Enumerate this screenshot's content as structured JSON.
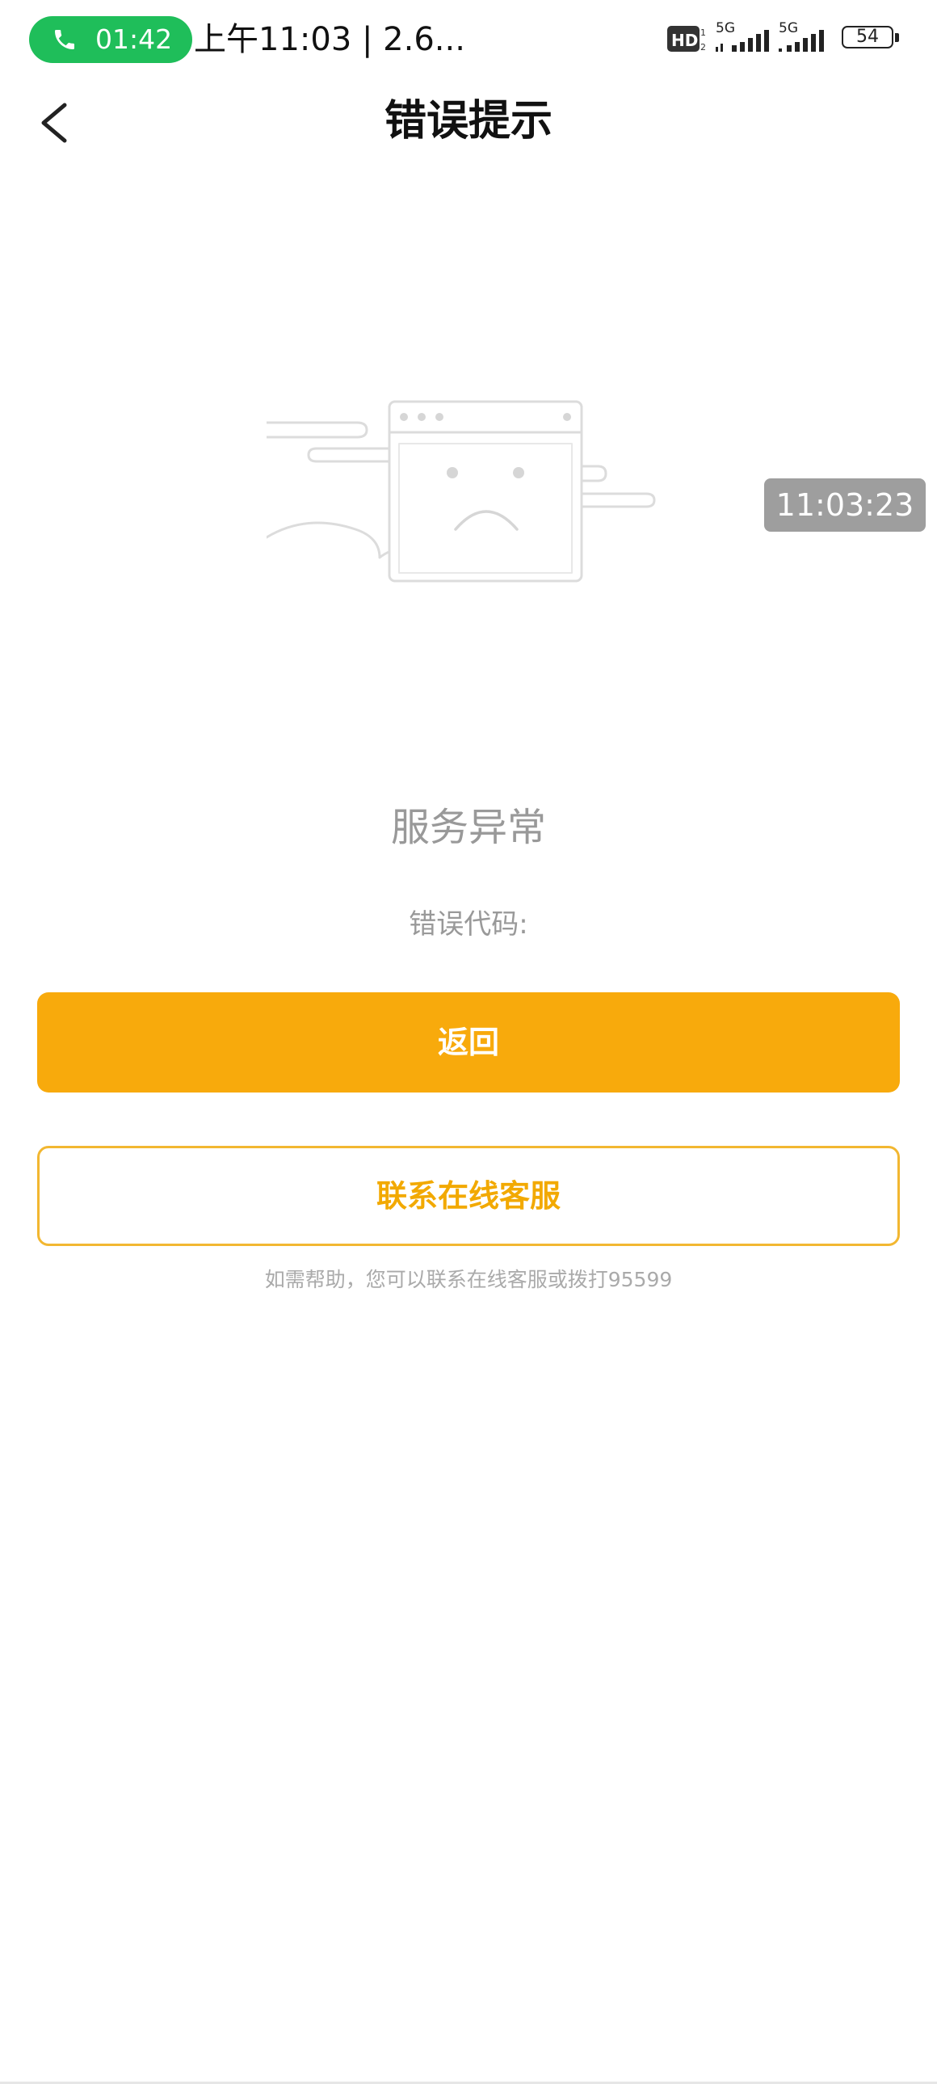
{
  "status_bar": {
    "call_timer": "01:42",
    "text": "上午11:03 | 2.6...",
    "hd_label": "HD",
    "network1": "5G",
    "network2": "5G",
    "battery": "54"
  },
  "nav": {
    "title": "错误提示"
  },
  "overlay": {
    "timestamp": "11:03:23"
  },
  "main": {
    "error_title": "服务异常",
    "error_code_label": "错误代码:",
    "back_button": "返回",
    "service_button": "联系在线客服",
    "help_text": "如需帮助，您可以联系在线客服或拨打95599"
  },
  "colors": {
    "primary": "#f8aa0c",
    "call_green": "#1fbe5a",
    "muted_text": "#999999"
  }
}
